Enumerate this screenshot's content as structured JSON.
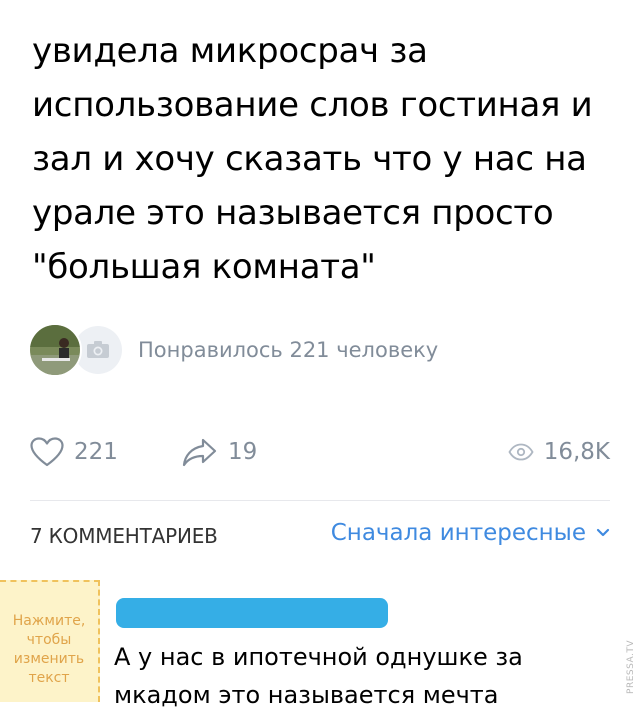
{
  "post": {
    "text": "увидела микросрач за\nиспользование слов гостиная и\nзал и хочу сказать что у нас на\nурале это называется просто\n\"большая комната\""
  },
  "likers": {
    "text": "Понравилось 221 человеку",
    "avatar_icon": "user-photo",
    "placeholder_icon": "camera-icon"
  },
  "actions": {
    "likes": "221",
    "shares": "19",
    "views": "16,8K"
  },
  "comments": {
    "count_label": "7 КОММЕНТАРИЕВ",
    "sort_label": "Сначала интересные",
    "first": {
      "author": "",
      "text": "А у нас в ипотечной однушке за\nмкадом это называется мечта"
    }
  },
  "sticky_note": {
    "text": "Нажмите,\nчтобы\nизменить\nтекст"
  },
  "watermark": "PRESSA.TV",
  "colors": {
    "accent": "#3f8ae0",
    "muted": "#818c99",
    "name_redaction": "#35aee6",
    "note_bg": "#fdf3c9"
  }
}
